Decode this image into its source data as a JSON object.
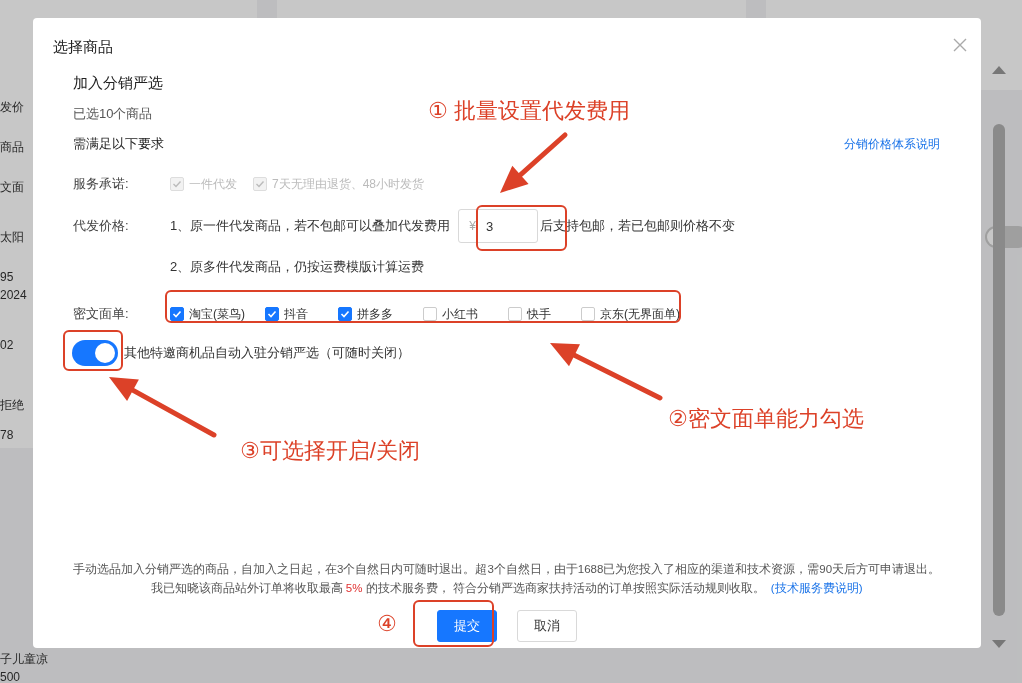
{
  "background": {
    "side_texts": [
      "发价",
      "商品",
      "文面",
      "太阳",
      "95",
      "2024",
      "02",
      "拒绝",
      "78"
    ],
    "bottom_text": "子儿童凉",
    "bottom_sub": "500",
    "switch": {
      "on": false
    }
  },
  "dialog": {
    "title": "选择商品",
    "section": "加入分销严选",
    "selected_count": "已选10个商品",
    "requirement": "需满足以下要求",
    "help_link": "分销价格体系说明",
    "service": {
      "label": "服务承诺:",
      "options": [
        {
          "label": "一件代发",
          "checked": true,
          "disabled": true
        },
        {
          "label": "7天无理由退货、48小时发货",
          "checked": true,
          "disabled": true
        }
      ]
    },
    "price": {
      "label": "代发价格:",
      "line1_before": "1、原一件代发商品，若不包邮可以叠加代发费用",
      "currency": "¥",
      "value": "3",
      "line1_after": "后支持包邮，若已包邮则价格不变",
      "line2": "2、原多件代发商品，仍按运费模版计算运费"
    },
    "waybill": {
      "label": "密文面单:",
      "options": [
        {
          "label": "淘宝(菜鸟)",
          "checked": true
        },
        {
          "label": "抖音",
          "checked": true
        },
        {
          "label": "拼多多",
          "checked": true
        },
        {
          "label": "小红书",
          "checked": false
        },
        {
          "label": "快手",
          "checked": false
        },
        {
          "label": "京东(无界面单)",
          "checked": false
        }
      ]
    },
    "auto_join": {
      "on": true,
      "label": "其他特邀商机品自动入驻分销严选（可随时关闭）"
    },
    "notice": "手动选品加入分销严选的商品，自加入之日起，在3个自然日内可随时退出。超3个自然日，由于1688已为您投入了相应的渠道和技术资源，需90天后方可申请退出。",
    "agreement": "我已知晓该商品站外订单将收取最高 **5%** 的技术服务费， 符合分销严选商家扶持活动的订单按照实际活动规则收取。",
    "agreement_link": "(技术服务费说明)",
    "buttons": [
      {
        "label": "提交",
        "kind": "primary"
      },
      {
        "label": "取消",
        "kind": "default"
      }
    ]
  },
  "annotations": [
    {
      "text": "① 批量设置代发费用"
    },
    {
      "text": "②密文面单能力勾选"
    },
    {
      "text": "③可选择开启/关闭"
    },
    {
      "text": "④"
    }
  ]
}
